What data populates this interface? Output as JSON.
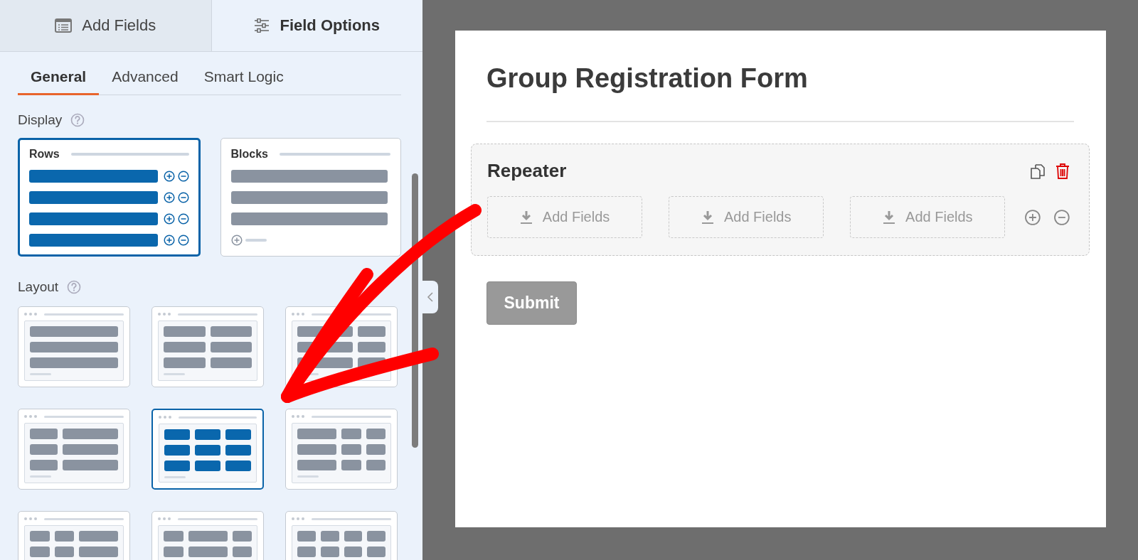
{
  "panel_tabs": [
    {
      "label": "Add Fields",
      "selected": false
    },
    {
      "label": "Field Options",
      "selected": true
    }
  ],
  "option_tabs": [
    {
      "label": "General",
      "selected": true
    },
    {
      "label": "Advanced",
      "selected": false
    },
    {
      "label": "Smart Logic",
      "selected": false
    }
  ],
  "display": {
    "label": "Display",
    "options": [
      {
        "kind": "rows",
        "label": "Rows",
        "selected": true
      },
      {
        "kind": "blocks",
        "label": "Blocks",
        "selected": false
      }
    ]
  },
  "layout": {
    "label": "Layout",
    "options": [
      {
        "kind": "full",
        "selected": false
      },
      {
        "kind": "halves",
        "selected": false
      },
      {
        "kind": "two-thirds-one-third",
        "selected": false
      },
      {
        "kind": "one-third-two-thirds",
        "selected": false
      },
      {
        "kind": "thirds",
        "selected": true
      },
      {
        "kind": "half-quarter-quarter",
        "selected": false
      },
      {
        "kind": "quarter-quarter-half",
        "selected": false
      },
      {
        "kind": "quarter-half-quarter",
        "selected": false
      },
      {
        "kind": "quarters",
        "selected": false
      }
    ]
  },
  "form": {
    "title": "Group Registration Form",
    "repeater": {
      "title": "Repeater",
      "slots": [
        "Add Fields",
        "Add Fields",
        "Add Fields"
      ]
    },
    "submit": "Submit"
  }
}
